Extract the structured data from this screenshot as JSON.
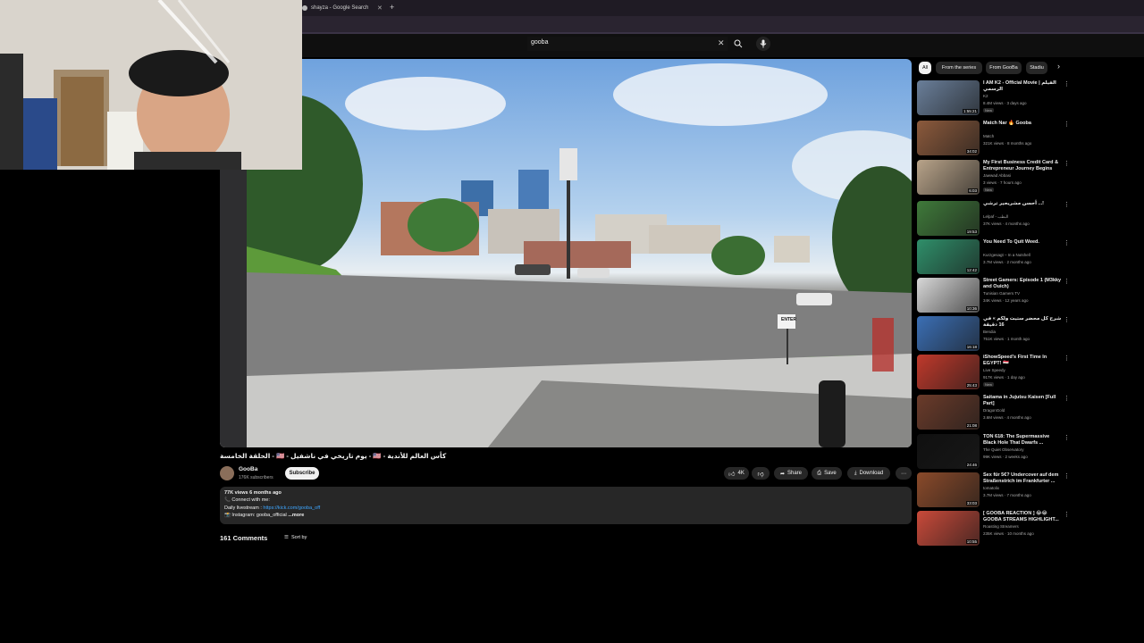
{
  "browser": {
    "tab_title": "shayza - Google Search",
    "new_tab": "+"
  },
  "search": {
    "value": "gooba",
    "clear": "✕"
  },
  "video": {
    "title": "الحلقة الخامسة - 🇺🇸 - يوم تاريخي في ناشفيل - 🇺🇸 - كأس العالم للأندية",
    "sign_text": "ENTER"
  },
  "channel": {
    "name": "GooBa",
    "subscribers": "176K subscribers",
    "subscribe_label": "Subscribe"
  },
  "actions": {
    "likes": "4K",
    "share": "Share",
    "save": "Save",
    "download": "Download",
    "more": "⋯"
  },
  "description": {
    "meta": "77K views  6 months ago",
    "line1": "📞 Connect with me:",
    "line2_label": "Daily livestream : ",
    "line2_link": "https://kick.com/gooba_off",
    "line3": "📸 Instagram: gooba_official",
    "more": "...more"
  },
  "comments": {
    "count_label": "161 Comments",
    "sort_label": "Sort by"
  },
  "chips": [
    "All",
    "From the series",
    "From GooBa",
    "Stadiu"
  ],
  "recommendations": [
    {
      "title": "I AM K2 - Official Movie | الفيلم الرسمي",
      "channel": "K2",
      "meta": "8.4M views · 3 days ago",
      "duration": "1:55:21",
      "badge": "New",
      "thumb": "#6a7f9a"
    },
    {
      "title": "Match Nar 🔥 Gooba",
      "channel": "Match",
      "meta": "321K views · 8 months ago",
      "duration": "34:02",
      "badge": "",
      "thumb": "#8c5a3c"
    },
    {
      "title": "My First Business Credit Card & Entrepreneur Journey Begins",
      "channel": "Jawwad Abbasi",
      "meta": "3 views · 7 hours ago",
      "duration": "6:03",
      "badge": "New",
      "thumb": "#b9a48a"
    },
    {
      "title": "أحسن مشريحير ترشي ...!",
      "channel": "Lelpaf - البطب",
      "meta": "37K views · 4 months ago",
      "duration": "19:53",
      "badge": "",
      "thumb": "#3f7a3a"
    },
    {
      "title": "You Need To Quit Weed.",
      "channel": "Kurzgesagt – In a Nutshell",
      "meta": "3.7M views · 2 months ago",
      "duration": "12:42",
      "badge": "",
      "thumb": "#2f8f6a"
    },
    {
      "title": "Street Gamers: Episode 1 (M3kky and Ouich)",
      "channel": "Tunisian Gamers TV",
      "meta": "34K views · 12 years ago",
      "duration": "10:36",
      "badge": "",
      "thumb": "#d8d8d8"
    },
    {
      "title": "شرح كل محضر ستيت ولكم » في 16 دقيقة",
      "channel": "Bendia",
      "meta": "751K views · 1 month ago",
      "duration": "16:18",
      "badge": "",
      "thumb": "#3b6fb5"
    },
    {
      "title": "iShowSpeed's First Time In EGYPT! 🇪🇬",
      "channel": "Live Speedy",
      "meta": "917K views · 1 day ago",
      "duration": "25:43",
      "badge": "New",
      "thumb": "#c0392b"
    },
    {
      "title": "Saitama in Jujutsu Kaisen [Full Part]",
      "channel": "DragonGold",
      "meta": "3.6M views · 4 months ago",
      "duration": "21:08",
      "badge": "",
      "thumb": "#6b3b2a"
    },
    {
      "title": "TON 618: The Supermassive Black Hole That Dwarfs ...",
      "channel": "The Quiet Observatory",
      "meta": "99K views · 2 weeks ago",
      "duration": "24:46",
      "badge": "",
      "thumb": "#101010"
    },
    {
      "title": "Sex für 5€? Undercover auf dem Straßenstrich im Frankfurter ...",
      "channel": "tomatolix",
      "meta": "3.7M views · 7 months ago",
      "duration": "33:03",
      "badge": "",
      "thumb": "#8a4a2a"
    },
    {
      "title": "[ GOOBA REACTION ] 😂😂 GOOBA STREAMS HIGHLIGHT...",
      "channel": "Roasting Streamers",
      "meta": "235K views · 10 months ago",
      "duration": "10:55",
      "badge": "",
      "thumb": "#c94a3a"
    }
  ],
  "colors": {
    "accent": "#f1f1f1",
    "background": "#0f0f0f",
    "pill": "#272727",
    "link": "#3ea6ff"
  }
}
